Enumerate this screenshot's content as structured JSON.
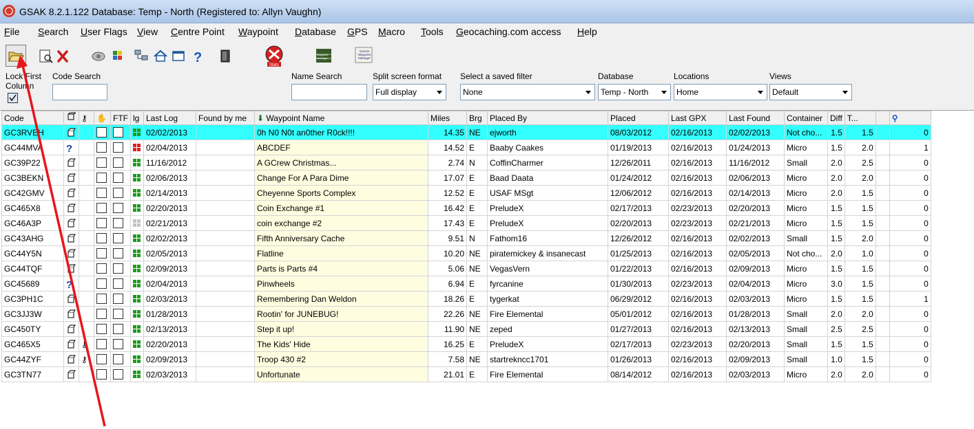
{
  "window": {
    "title": "GSAK 8.2.1.122   Database: Temp - North   (Registered to: Allyn Vaughn)"
  },
  "menu": [
    {
      "text": "File",
      "u": "F",
      "rest": "ile"
    },
    {
      "text": "Search",
      "u": "S",
      "rest": "earch"
    },
    {
      "text": "User Flags",
      "u": "U",
      "rest": "ser Flags"
    },
    {
      "text": "View",
      "u": "V",
      "rest": "iew"
    },
    {
      "text": "Centre Point",
      "u": "C",
      "rest": "entre Point"
    },
    {
      "text": "Waypoint",
      "u": "W",
      "rest": "aypoint"
    },
    {
      "text": "Database",
      "u": "D",
      "rest": "atabase"
    },
    {
      "text": "GPS",
      "u": "G",
      "rest": "PS"
    },
    {
      "text": "Macro",
      "u": "M",
      "rest": "acro"
    },
    {
      "text": "Tools",
      "u": "T",
      "rest": "ools"
    },
    {
      "text": "Geocaching.com access",
      "u": "G",
      "rest": "eocaching.com access"
    },
    {
      "text": "Help",
      "u": "H",
      "rest": "elp"
    }
  ],
  "toolbar": {
    "stats_label": "Stats",
    "waypoint_manager_label": "Waypoint Manager",
    "garmin_manager_label": "Garmin Waypoint Manager"
  },
  "filters": {
    "lock_label_1": "Lock First",
    "lock_label_2": "Column",
    "code_search_label": "Code Search",
    "code_search_value": "",
    "name_search_label": "Name Search",
    "name_search_value": "",
    "split_label": "Split screen format",
    "split_value": "Full display",
    "saved_filter_label": "Select a saved filter",
    "saved_filter_value": "None",
    "database_label": "Database",
    "database_value": "Temp - North",
    "locations_label": "Locations",
    "locations_value": "Home",
    "views_label": "Views",
    "views_value": "Default"
  },
  "columns": [
    "Code",
    "",
    "",
    "",
    "FTF",
    "lg",
    "Last Log",
    "Found by me",
    "Waypoint Name",
    "Miles",
    "Brg",
    "Placed By",
    "Placed",
    "Last GPX",
    "Last Found",
    "Container",
    "Diff",
    "T...",
    "",
    ""
  ],
  "rows": [
    {
      "code": "GC3RVEH",
      "type": "trad",
      "tb": false,
      "lg": "green",
      "last_log": "02/02/2013",
      "found": "",
      "name": "0h N0 N0t an0ther R0ck!!!!",
      "miles": "14.35",
      "brg": "NE",
      "placed_by": "ejworth",
      "placed": "08/03/2012",
      "last_gpx": "02/16/2013",
      "last_found": "02/02/2013",
      "container": "Not cho...",
      "diff": "1.5",
      "terr": "1.5",
      "fav": "0",
      "selected": true
    },
    {
      "code": "GC44MVA",
      "type": "mystery",
      "tb": false,
      "lg": "red",
      "last_log": "02/04/2013",
      "found": "",
      "name": "ABCDEF",
      "miles": "14.52",
      "brg": "E",
      "placed_by": "Baaby Caakes",
      "placed": "01/19/2013",
      "last_gpx": "02/16/2013",
      "last_found": "01/24/2013",
      "container": "Micro",
      "diff": "1.5",
      "terr": "2.0",
      "fav": "1"
    },
    {
      "code": "GC39P22",
      "type": "trad",
      "tb": false,
      "lg": "green",
      "last_log": "11/16/2012",
      "found": "",
      "name": "A GCrew Christmas...",
      "miles": "2.74",
      "brg": "N",
      "placed_by": "CoffinCharmer",
      "placed": "12/26/2011",
      "last_gpx": "02/16/2013",
      "last_found": "11/16/2012",
      "container": "Small",
      "diff": "2.0",
      "terr": "2.5",
      "fav": "0"
    },
    {
      "code": "GC3BEKN",
      "type": "trad",
      "tb": false,
      "lg": "green",
      "last_log": "02/06/2013",
      "found": "",
      "name": "Change For A Para Dime",
      "miles": "17.07",
      "brg": "E",
      "placed_by": "Baad Daata",
      "placed": "01/24/2012",
      "last_gpx": "02/16/2013",
      "last_found": "02/06/2013",
      "container": "Micro",
      "diff": "2.0",
      "terr": "2.0",
      "fav": "0"
    },
    {
      "code": "GC42GMV",
      "type": "trad",
      "tb": false,
      "lg": "green",
      "last_log": "02/14/2013",
      "found": "",
      "name": "Cheyenne Sports Complex",
      "miles": "12.52",
      "brg": "E",
      "placed_by": "USAF MSgt",
      "placed": "12/06/2012",
      "last_gpx": "02/16/2013",
      "last_found": "02/14/2013",
      "container": "Micro",
      "diff": "2.0",
      "terr": "1.5",
      "fav": "0"
    },
    {
      "code": "GC465X8",
      "type": "trad",
      "tb": false,
      "lg": "green",
      "last_log": "02/20/2013",
      "found": "",
      "name": "Coin Exchange #1",
      "miles": "16.42",
      "brg": "E",
      "placed_by": "PreludeX",
      "placed": "02/17/2013",
      "last_gpx": "02/23/2013",
      "last_found": "02/20/2013",
      "container": "Micro",
      "diff": "1.5",
      "terr": "1.5",
      "fav": "0"
    },
    {
      "code": "GC46A3P",
      "type": "trad",
      "tb": false,
      "lg": "gray",
      "last_log": "02/21/2013",
      "found": "",
      "name": "coin exchange #2",
      "miles": "17.43",
      "brg": "E",
      "placed_by": "PreludeX",
      "placed": "02/20/2013",
      "last_gpx": "02/23/2013",
      "last_found": "02/21/2013",
      "container": "Micro",
      "diff": "1.5",
      "terr": "1.5",
      "fav": "0"
    },
    {
      "code": "GC43AHG",
      "type": "trad",
      "tb": false,
      "lg": "green",
      "last_log": "02/02/2013",
      "found": "",
      "name": "Fifth Anniversary Cache",
      "miles": "9.51",
      "brg": "N",
      "placed_by": "Fathom16",
      "placed": "12/26/2012",
      "last_gpx": "02/16/2013",
      "last_found": "02/02/2013",
      "container": "Small",
      "diff": "1.5",
      "terr": "2.0",
      "fav": "0"
    },
    {
      "code": "GC44Y5N",
      "type": "trad",
      "tb": false,
      "lg": "green",
      "last_log": "02/05/2013",
      "found": "",
      "name": "Flatline",
      "miles": "10.20",
      "brg": "NE",
      "placed_by": "piratemickey & insanecast",
      "placed": "01/25/2013",
      "last_gpx": "02/16/2013",
      "last_found": "02/05/2013",
      "container": "Not cho...",
      "diff": "2.0",
      "terr": "1.0",
      "fav": "0"
    },
    {
      "code": "GC44TQF",
      "type": "trad",
      "tb": false,
      "lg": "green",
      "last_log": "02/09/2013",
      "found": "",
      "name": "Parts is Parts #4",
      "miles": "5.06",
      "brg": "NE",
      "placed_by": "VegasVern",
      "placed": "01/22/2013",
      "last_gpx": "02/16/2013",
      "last_found": "02/09/2013",
      "container": "Micro",
      "diff": "1.5",
      "terr": "1.5",
      "fav": "0"
    },
    {
      "code": "GC45689",
      "type": "mystery",
      "tb": false,
      "lg": "green",
      "last_log": "02/04/2013",
      "found": "",
      "name": "Pinwheels",
      "miles": "6.94",
      "brg": "E",
      "placed_by": "fyrcanine",
      "placed": "01/30/2013",
      "last_gpx": "02/23/2013",
      "last_found": "02/04/2013",
      "container": "Micro",
      "diff": "3.0",
      "terr": "1.5",
      "fav": "0"
    },
    {
      "code": "GC3PH1C",
      "type": "trad",
      "tb": false,
      "lg": "green",
      "last_log": "02/03/2013",
      "found": "",
      "name": "Remembering Dan Weldon",
      "miles": "18.26",
      "brg": "E",
      "placed_by": "tygerkat",
      "placed": "06/29/2012",
      "last_gpx": "02/16/2013",
      "last_found": "02/03/2013",
      "container": "Micro",
      "diff": "1.5",
      "terr": "1.5",
      "fav": "1"
    },
    {
      "code": "GC3JJ3W",
      "type": "trad",
      "tb": false,
      "lg": "green",
      "last_log": "01/28/2013",
      "found": "",
      "name": "Rootin' for JUNEBUG!",
      "miles": "22.26",
      "brg": "NE",
      "placed_by": "Fire Elemental",
      "placed": "05/01/2012",
      "last_gpx": "02/16/2013",
      "last_found": "01/28/2013",
      "container": "Small",
      "diff": "2.0",
      "terr": "2.0",
      "fav": "0"
    },
    {
      "code": "GC450TY",
      "type": "trad",
      "tb": false,
      "lg": "green",
      "last_log": "02/13/2013",
      "found": "",
      "name": "Step it up!",
      "miles": "11.90",
      "brg": "NE",
      "placed_by": "zeped",
      "placed": "01/27/2013",
      "last_gpx": "02/16/2013",
      "last_found": "02/13/2013",
      "container": "Small",
      "diff": "2.5",
      "terr": "2.5",
      "fav": "0"
    },
    {
      "code": "GC465X5",
      "type": "trad",
      "tb": true,
      "lg": "green",
      "last_log": "02/20/2013",
      "found": "",
      "name": "The Kids' Hide",
      "miles": "16.25",
      "brg": "E",
      "placed_by": "PreludeX",
      "placed": "02/17/2013",
      "last_gpx": "02/23/2013",
      "last_found": "02/20/2013",
      "container": "Small",
      "diff": "1.5",
      "terr": "1.5",
      "fav": "0"
    },
    {
      "code": "GC44ZYF",
      "type": "trad",
      "tb": true,
      "lg": "green",
      "last_log": "02/09/2013",
      "found": "",
      "name": "Troop 430 #2",
      "miles": "7.58",
      "brg": "NE",
      "placed_by": "startrekncc1701",
      "placed": "01/26/2013",
      "last_gpx": "02/16/2013",
      "last_found": "02/09/2013",
      "container": "Small",
      "diff": "1.0",
      "terr": "1.5",
      "fav": "0"
    },
    {
      "code": "GC3TN77",
      "type": "trad",
      "tb": false,
      "lg": "green",
      "last_log": "02/03/2013",
      "found": "",
      "name": "Unfortunate",
      "miles": "21.01",
      "brg": "E",
      "placed_by": "Fire Elemental",
      "placed": "08/14/2012",
      "last_gpx": "02/16/2013",
      "last_found": "02/03/2013",
      "container": "Micro",
      "diff": "2.0",
      "terr": "2.0",
      "fav": "0"
    }
  ],
  "colors": {
    "selected_row": "#33ffff",
    "waypoint_name_bg": "#fffde0",
    "annotation_arrow": "#e8151b"
  }
}
